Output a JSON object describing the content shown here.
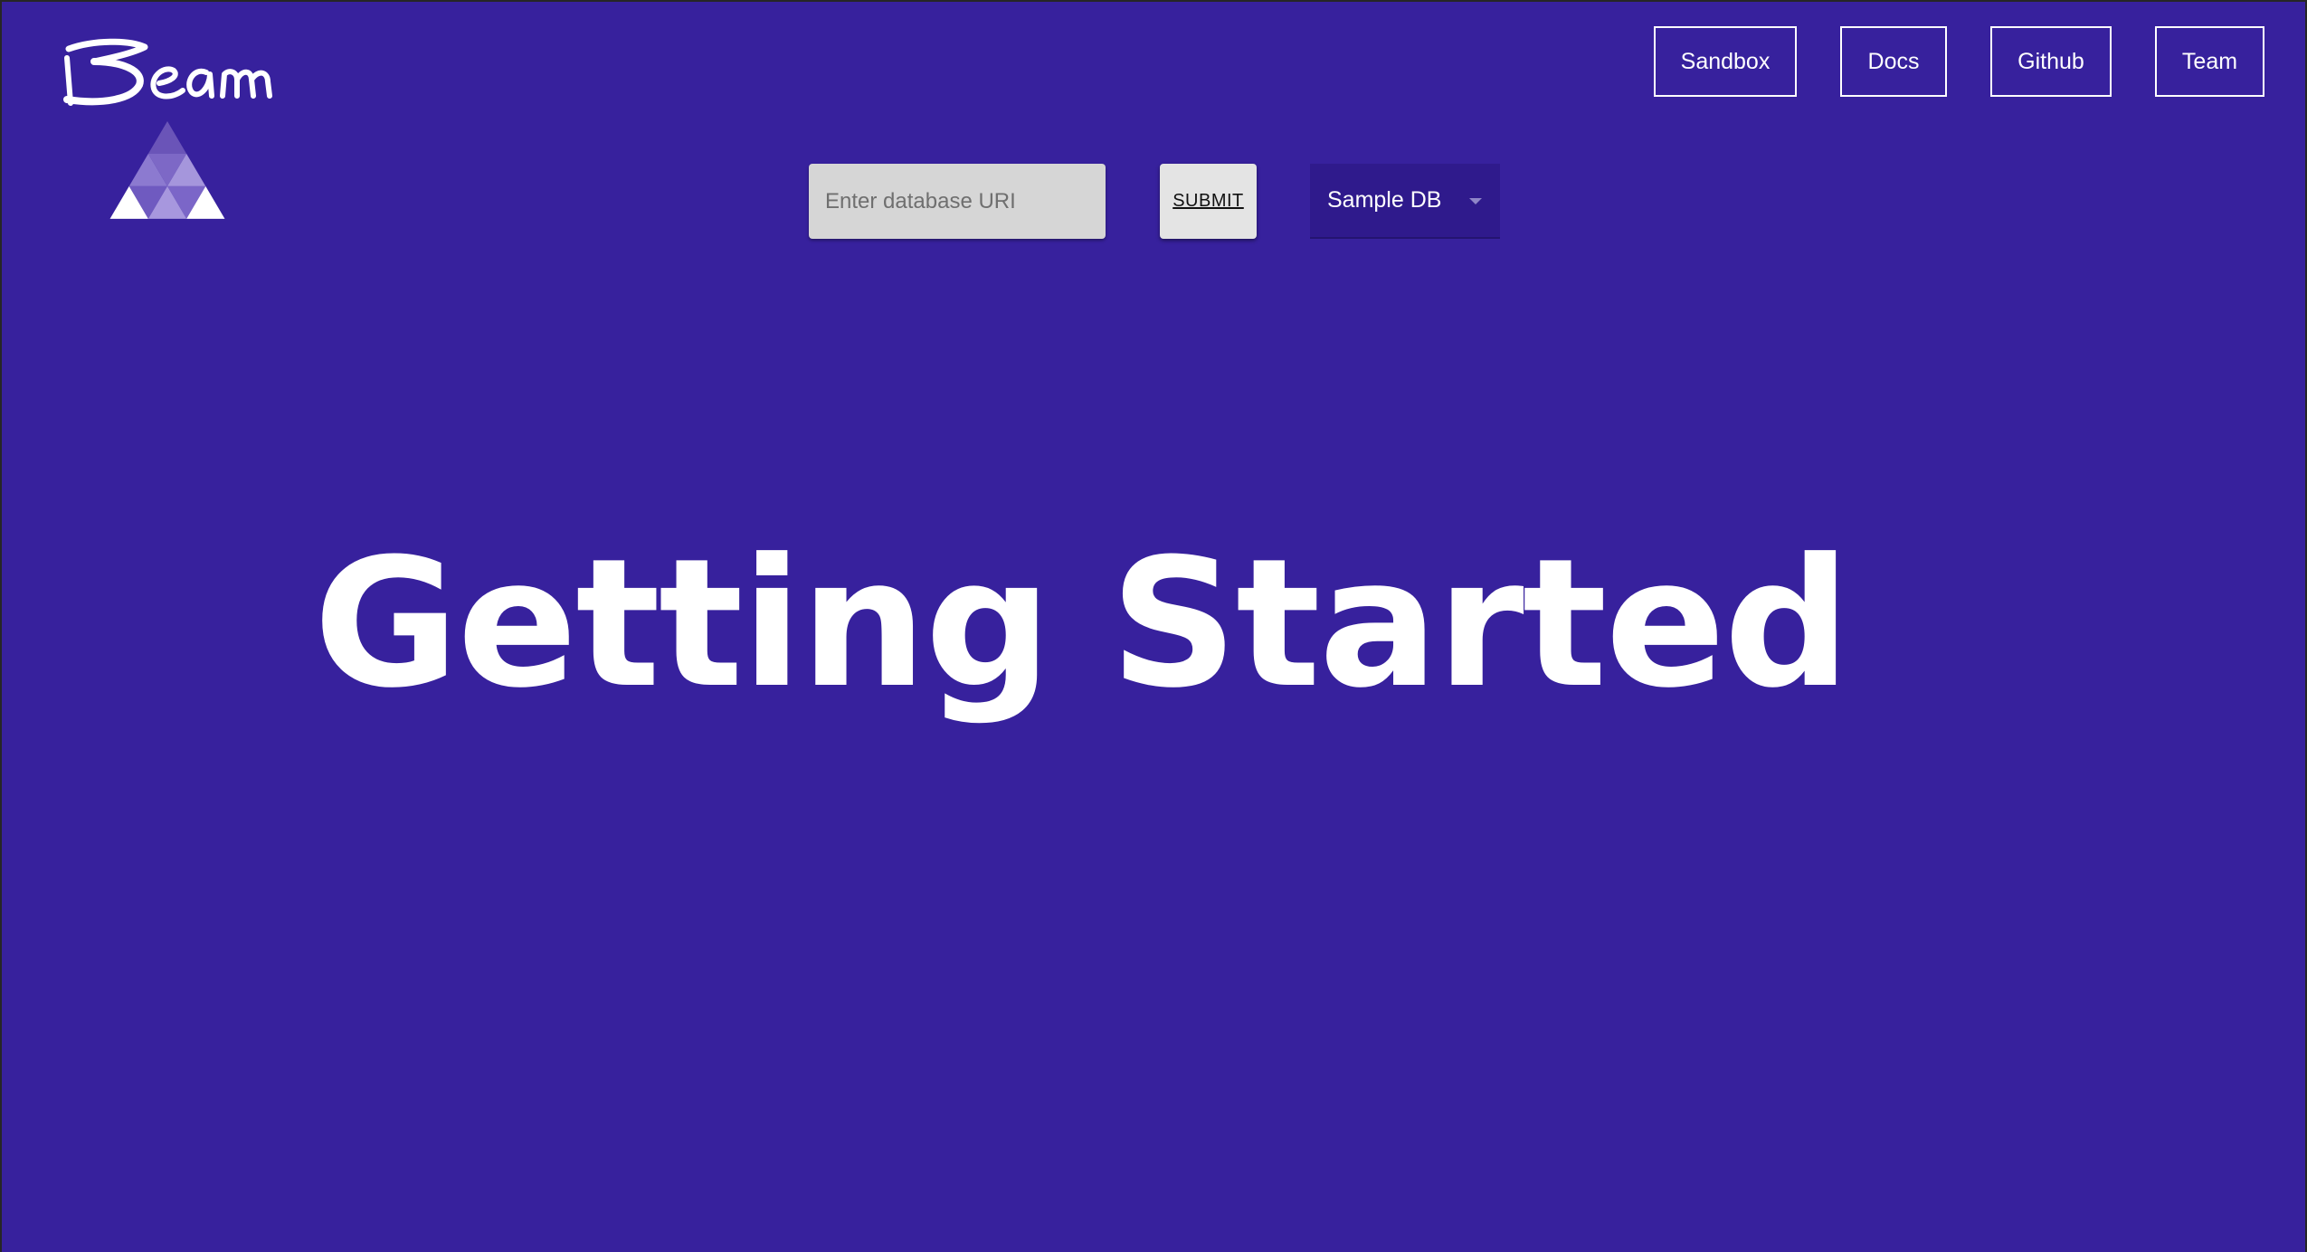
{
  "app": {
    "logo_text": "Beam"
  },
  "nav": {
    "items": [
      {
        "label": "Sandbox"
      },
      {
        "label": "Docs"
      },
      {
        "label": "Github"
      },
      {
        "label": "Team"
      }
    ]
  },
  "toolbar": {
    "uri_placeholder": "Enter database URI",
    "uri_value": "",
    "submit_label": "SUBMIT",
    "db_select_value": "Sample DB",
    "db_select_icon": "chevron-down-icon"
  },
  "hero": {
    "title": "Getting Started"
  },
  "colors": {
    "background": "#37219d",
    "input_bg": "#d6d6d6",
    "button_bg": "#e4e4e4",
    "select_bg": "#2f1a8c",
    "text": "#ffffff"
  }
}
